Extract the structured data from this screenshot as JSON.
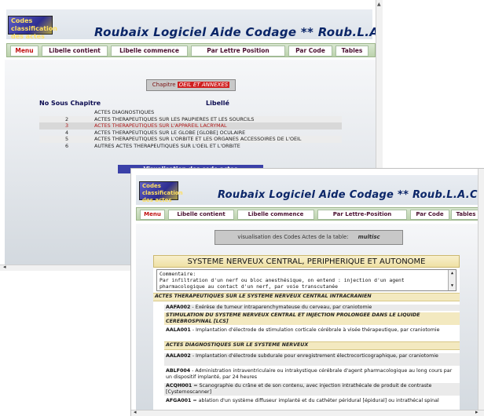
{
  "back_window": {
    "logo_text": "Codes\nclassification\ndes actes",
    "title": "Roubaix Logiciel Aide Codage   ** Roub.L.A.C. **",
    "nav": [
      "Menu",
      "Libelle contient",
      "Libelle commence",
      "Par Lettre Position",
      "Par Code",
      "Tables"
    ],
    "chapitre_label": "Chapitre",
    "chapitre_value": "OEIL ET ANNEXES",
    "col_no": "No Sous Chapitre",
    "col_libelle": "Libellé",
    "rows": [
      {
        "no": "",
        "label": "ACTES DIAGNOSTIQUES"
      },
      {
        "no": "2",
        "label": "ACTES THERAPEUTIQUES SUR LES PAUPIERES ET LES SOURCILS"
      },
      {
        "no": "3",
        "label": "ACTES THERAPEUTIQUES SUR L'APPAREIL LACRYMAL"
      },
      {
        "no": "4",
        "label": "ACTES THERAPEUTIQUES SUR LE GLOBE [GLOBE] OCULAIRE"
      },
      {
        "no": "5",
        "label": "ACTES THERAPEUTIQUES SUR L'ORBITE ET LES ORGANES ACCESSOIRES DE L'OEIL"
      },
      {
        "no": "6",
        "label": "AUTRES ACTES THERAPEUTIQUES SUR L'OEIL ET L'ORBITE"
      }
    ],
    "visualisation": "Visualisation des code actes"
  },
  "front_window": {
    "logo_text": "Codes\nclassification\ndes actes",
    "title": "Roubaix Logiciel Aide Codage   ** Roub.L.A.C. **",
    "nav": [
      "Menu",
      "Libelle contient",
      "Libelle commence",
      "Par Lettre-Position",
      "Par Code",
      "Tables"
    ],
    "vis_table_label": "visualisation des Codes Actes de la table:",
    "vis_table_value": "multisc",
    "system_title": "SYSTEME NERVEUX CENTRAL, PERIPHERIQUE ET AUTONOME",
    "comment_label": "Commentaire:",
    "comment_text": "Par infiltration d'un nerf ou bloc anesthésique, on entend : injection d'un agent pharmacologique au contact d'un nerf, par voie transcutanée",
    "items": [
      {
        "kind": "sec",
        "text": "ACTES THERAPEUTIQUES SUR LE SYSTEME NERVEUX CENTRAL INTRACRANIEN"
      },
      {
        "kind": "act",
        "code": "AAFA002",
        "text": " - Exérèse de tumeur intraparenchymateuse du cerveau, par craniotomie"
      },
      {
        "kind": "sub",
        "text": "STIMULATION DU SYSTEME NERVEUX CENTRAL ET INJECTION PROLONGEE DANS LE LIQUIDE CEREBROSPINAL [LCS]"
      },
      {
        "kind": "act",
        "code": "AALA001",
        "text": " - Implantation d'électrode de stimulation corticale cérébrale à visée thérapeutique, par craniotomie"
      },
      {
        "kind": "sec",
        "text": "ACTES DIAGNOSTIQUES SUR LE SYSTEME NERVEUX"
      },
      {
        "kind": "act",
        "code": "AALA002",
        "text": " - Implantation d'électrode subdurale pour enregistrement électrocorticographique, par craniotomie"
      },
      {
        "kind": "act",
        "code": "ABLF004",
        "text": " - Administration intraventriculaire ou intrakystique cérébrale d'agent pharmacologique au long cours par un dispositif implanté, par 24 heures"
      },
      {
        "kind": "act",
        "code": "ACQH001",
        "text": " = Scanographie du crâne et de son contenu, avec injection intrathécale de produit de contraste [Cysternoscanner]"
      },
      {
        "kind": "act",
        "code": "AFGA001",
        "text": " = ablation d'un système diffuseur implanté et du cathéter péridural [épidural] ou intrathécal spinal"
      }
    ]
  }
}
